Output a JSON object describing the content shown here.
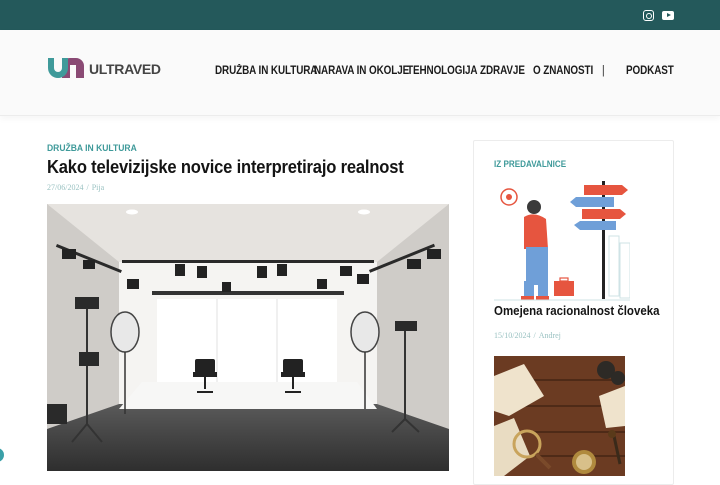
{
  "brand": {
    "logo_text_a": "ULTRA",
    "logo_text_b": "VED"
  },
  "colors": {
    "topbar": "#24595b",
    "accent": "#3f9a9a",
    "meta": "#9ac2c2"
  },
  "social": [
    "instagram-icon",
    "youtube-icon"
  ],
  "nav": {
    "items": [
      "DRUŽBA IN KULTURA",
      "NARAVA IN OKOLJE",
      "TEHNOLOGIJA",
      "ZDRAVJE",
      "O ZNANOSTI",
      "|",
      "PODKAST"
    ]
  },
  "article": {
    "category": "DRUŽBA IN KULTURA",
    "title": "Kako televizijske novice interpretirajo realnost",
    "date": "27/06/2024",
    "separator": "/",
    "author": "Pija"
  },
  "sidebar": {
    "label": "IZ PREDAVALNICE",
    "post_title": "Omejena racionalnost človeka",
    "post_date": "15/10/2024",
    "separator": "/",
    "post_author": "Andrej"
  }
}
